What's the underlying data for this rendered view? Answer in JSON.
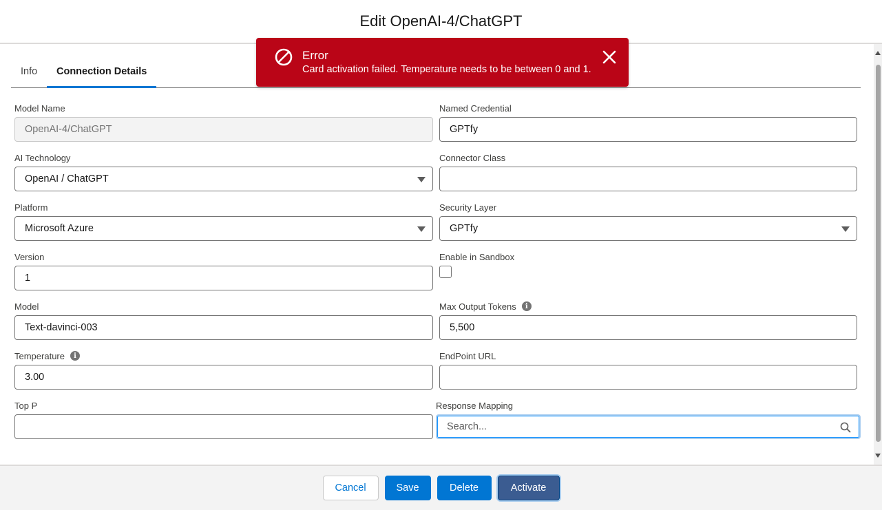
{
  "header": {
    "title": "Edit OpenAI-4/ChatGPT"
  },
  "tabs": [
    {
      "label": "Info"
    },
    {
      "label": "Connection Details"
    }
  ],
  "toast": {
    "title": "Error",
    "message": "Card activation failed. Temperature needs to be between 0 and 1.",
    "color": "#ba0517"
  },
  "fields": {
    "model_name": {
      "label": "Model Name",
      "value": "OpenAI-4/ChatGPT"
    },
    "named_credential": {
      "label": "Named Credential",
      "value": "GPTfy"
    },
    "ai_technology": {
      "label": "AI Technology",
      "value": "OpenAI / ChatGPT"
    },
    "connector_class": {
      "label": "Connector Class",
      "value": ""
    },
    "platform": {
      "label": "Platform",
      "value": "Microsoft Azure"
    },
    "security_layer": {
      "label": "Security Layer",
      "value": "GPTfy"
    },
    "version": {
      "label": "Version",
      "value": "1"
    },
    "enable_in_sandbox": {
      "label": "Enable in Sandbox",
      "checked": false
    },
    "model": {
      "label": "Model",
      "value": "Text-davinci-003"
    },
    "max_output_tokens": {
      "label": "Max Output Tokens",
      "value": "5,500"
    },
    "temperature": {
      "label": "Temperature",
      "value": "3.00"
    },
    "endpoint_url": {
      "label": "EndPoint URL",
      "value": ""
    },
    "top_p": {
      "label": "Top P",
      "value": ""
    },
    "response_mapping": {
      "label": "Response Mapping",
      "placeholder": "Search..."
    }
  },
  "footer": {
    "cancel_label": "Cancel",
    "save_label": "Save",
    "delete_label": "Delete",
    "activate_label": "Activate"
  },
  "colors": {
    "brand": "#0176d3",
    "activate": "#3b5c91",
    "error": "#ba0517"
  }
}
